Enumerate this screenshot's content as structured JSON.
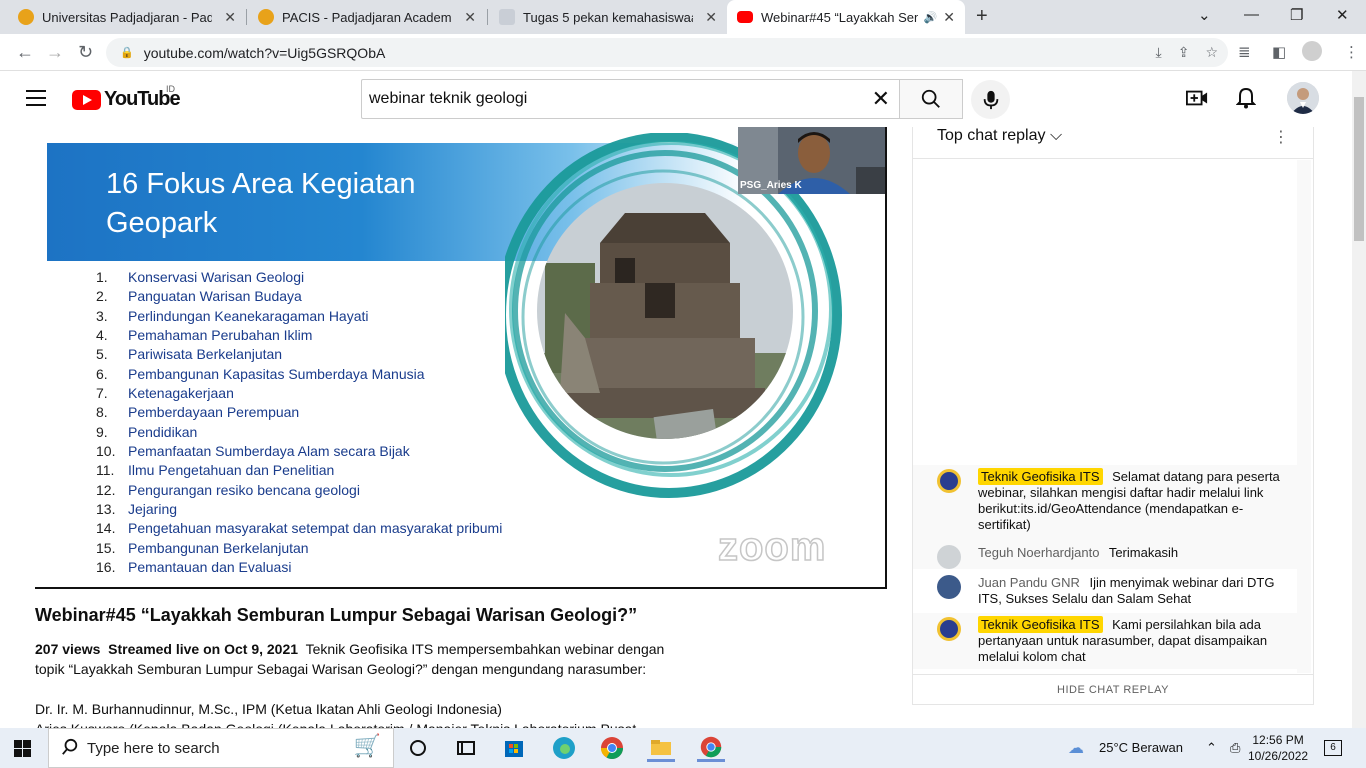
{
  "browser": {
    "tabs": [
      {
        "title": "Universitas Padjadjaran - Padjadja",
        "active": false
      },
      {
        "title": "PACIS - Padjadjaran Academics Ir",
        "active": false
      },
      {
        "title": "Tugas 5 pekan kemahasiswaan",
        "active": false
      },
      {
        "title": "Webinar#45 “Layakkah Semb",
        "active": true
      }
    ],
    "url": "youtube.com/watch?v=Uig5GSRQObA"
  },
  "youtube": {
    "logo_text": "YouTube",
    "country": "ID",
    "search_value": "webinar teknik geologi"
  },
  "slide": {
    "title_line1": "16 Fokus Area Kegiatan",
    "title_line2": "Geopark",
    "items": [
      {
        "num": "1.",
        "text": "Konservasi Warisan Geologi"
      },
      {
        "num": "2.",
        "text": "Panguatan Warisan Budaya"
      },
      {
        "num": "3.",
        "text": "Perlindungan Keanekaragaman Hayati"
      },
      {
        "num": "4.",
        "text": "Pemahaman Perubahan Iklim"
      },
      {
        "num": "5.",
        "text": "Pariwisata Berkelanjutan"
      },
      {
        "num": "6.",
        "text": "Pembangunan Kapasitas Sumberdaya Manusia"
      },
      {
        "num": "7.",
        "text": "Ketenagakerjaan"
      },
      {
        "num": "8.",
        "text": "Pemberdayaan Perempuan"
      },
      {
        "num": "9.",
        "text": "Pendidikan"
      },
      {
        "num": "10.",
        "text": "Pemanfaatan Sumberdaya Alam secara Bijak"
      },
      {
        "num": "11.",
        "text": "Ilmu Pengetahuan dan Penelitian"
      },
      {
        "num": "12.",
        "text": "Pengurangan resiko bencana geologi"
      },
      {
        "num": "13.",
        "text": "Jejaring"
      },
      {
        "num": "14.",
        "text": "Pengetahuan masyarakat setempat dan masyarakat pribumi"
      },
      {
        "num": "15.",
        "text": "Pembangunan Berkelanjutan"
      },
      {
        "num": "16.",
        "text": "Pemantauan dan Evaluasi"
      }
    ],
    "camera_label": "PSG_Aries K",
    "watermark": "zoom"
  },
  "video": {
    "title": "Webinar#45 “Layakkah Semburan Lumpur Sebagai Warisan Geologi?”",
    "views": "207 views",
    "streamed": "Streamed live on Oct 9, 2021",
    "desc1": "Teknik Geofisika ITS mempersembahkan webinar dengan topik “Layakkah Semburan Lumpur Sebagai Warisan Geologi?” dengan mengundang narasumber:",
    "speaker1": "Dr. Ir. M. Burhannudinnur, M.Sc., IPM (Ketua Ikatan Ahli Geologi Indonesia)",
    "speaker2": "Aries Kusworo (Kepala Badan Geologi (Kepala Laboratorim / Manajer Teknis Laboratorium Pusat"
  },
  "chat": {
    "header": "Top chat replay",
    "footer": "HIDE CHAT REPLAY",
    "messages": [
      {
        "author": "Teknik Geofisika ITS",
        "text": "Selamat datang para peserta webinar, silahkan mengisi daftar hadir melalui link berikut:its.id/GeoAttendance (mendapatkan e-sertifikat)",
        "owner": true
      },
      {
        "author": "Teguh Noerhardjanto",
        "text": "Terimakasih",
        "owner": false
      },
      {
        "author": "Juan Pandu GNR",
        "text": "Ijin menyimak webinar dari DTG ITS, Sukses Selalu dan Salam Sehat",
        "owner": false
      },
      {
        "author": "Teknik Geofisika ITS",
        "text": "Kami persilahkan bila ada pertanyaan untuk narasumber, dapat disampaikan melalui kolom chat",
        "owner": true
      }
    ]
  },
  "taskbar": {
    "search_placeholder": "Type here to search",
    "weather": "25°C  Berawan",
    "time": "12:56 PM",
    "date": "10/26/2022",
    "notifications": "6"
  },
  "colors": {
    "yt_red": "#ff0000",
    "slide_blue": "#1d73c4",
    "ring_teal": "#1a9a9a",
    "owner_badge": "#ffd600"
  }
}
